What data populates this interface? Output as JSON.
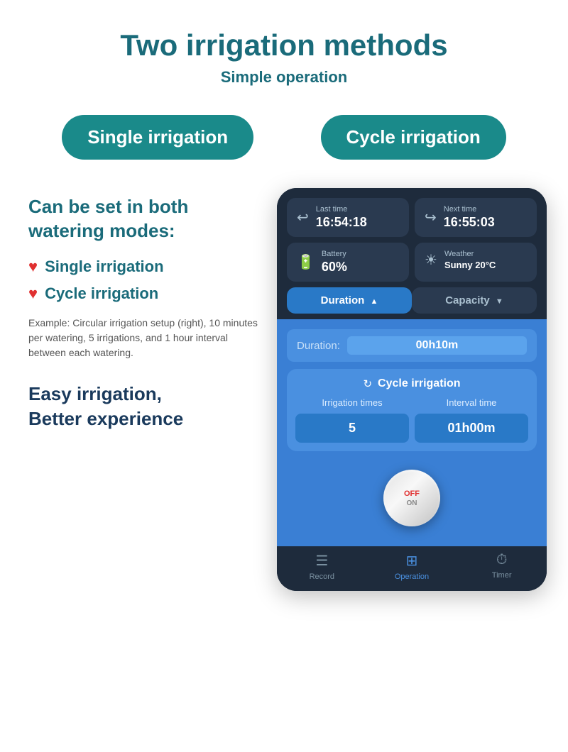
{
  "header": {
    "main_title": "Two irrigation methods",
    "sub_title": "Simple operation"
  },
  "badges": {
    "single": "Single irrigation",
    "cycle": "Cycle irrigation"
  },
  "left": {
    "can_set": "Can be set in both\nwatering modes:",
    "bullet1": "Single irrigation",
    "bullet2": "Cycle irrigation",
    "example": "Example: Circular irrigation setup (right), 10 minutes per watering, 5 irrigations, and 1 hour interval between each watering.",
    "easy_line1": "Easy irrigation,",
    "easy_line2": "Better experience"
  },
  "phone": {
    "last_time_label": "Last time",
    "last_time_value": "16:54:18",
    "next_time_label": "Next time",
    "next_time_value": "16:55:03",
    "battery_label": "Battery",
    "battery_value": "60%",
    "weather_label": "Weather",
    "weather_value": "Sunny 20°C",
    "tab_duration": "Duration",
    "tab_capacity": "Capacity",
    "duration_label": "Duration:",
    "duration_value": "00h10m",
    "cycle_icon": "↻",
    "cycle_title": "Cycle irrigation",
    "irrigation_times_label": "Irrigation times",
    "interval_time_label": "Interval time",
    "irrigation_times_value": "5",
    "interval_time_value": "01h00m",
    "knob_off": "OFF",
    "knob_on": "ON",
    "nav_record": "Record",
    "nav_operation": "Operation",
    "nav_timer": "Timer"
  }
}
